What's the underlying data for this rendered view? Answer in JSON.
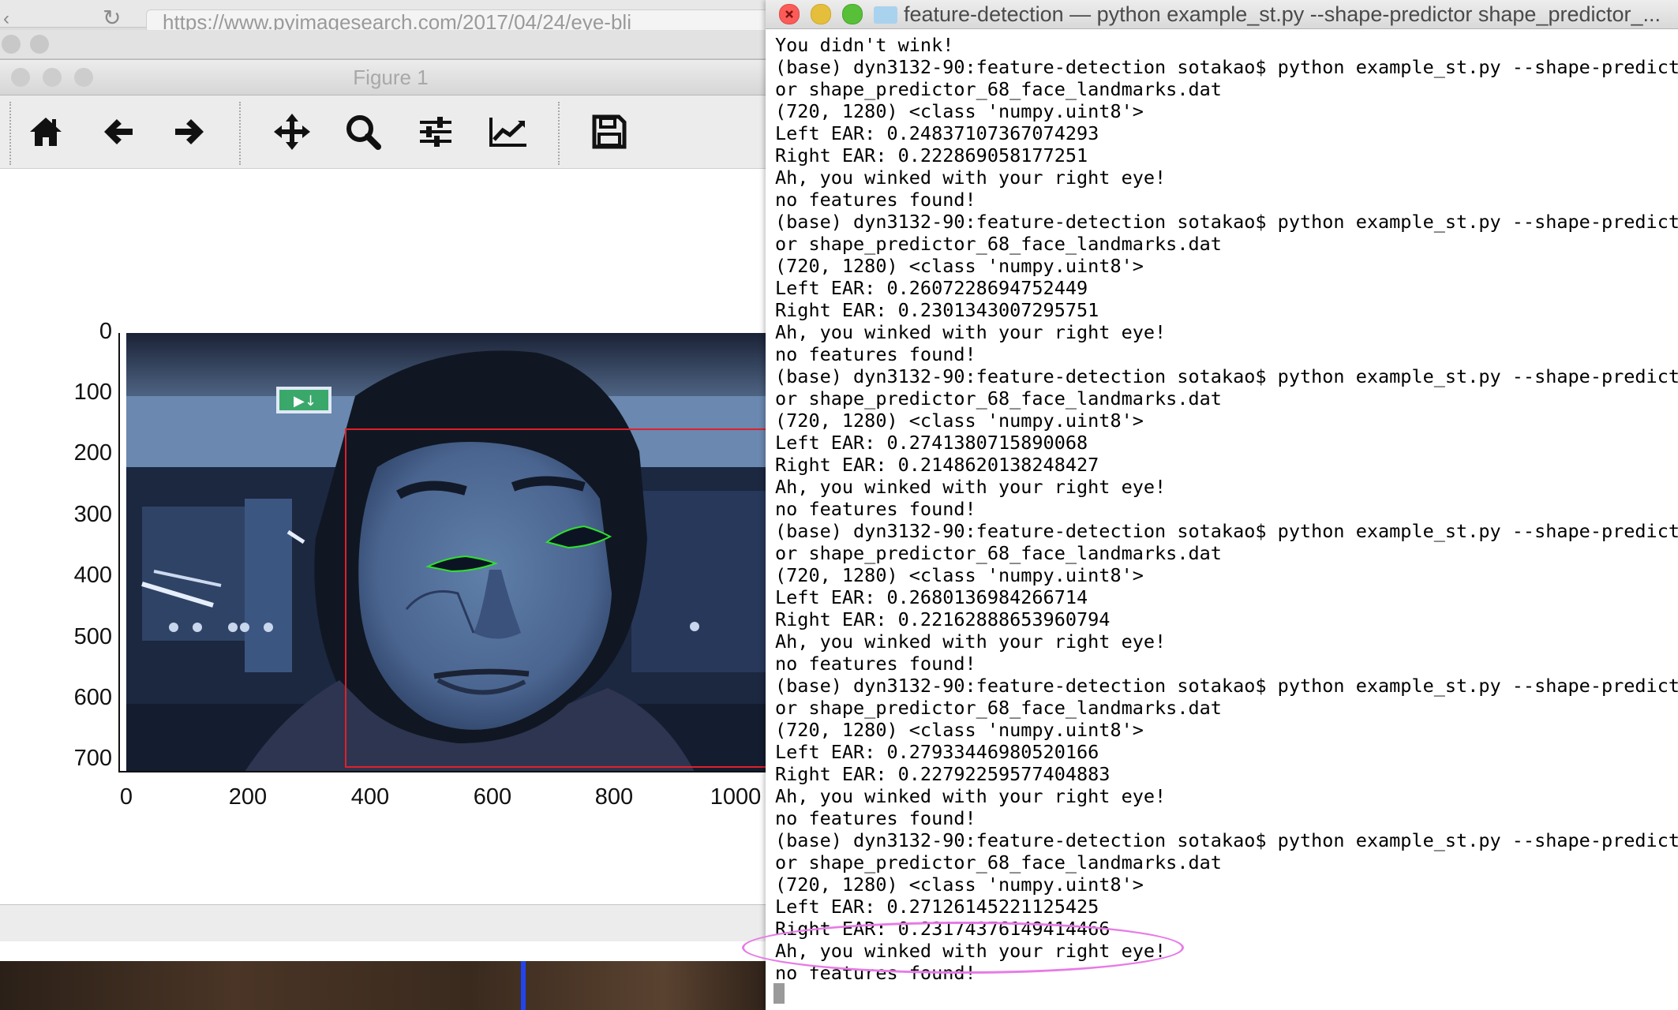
{
  "background_browser": {
    "address_text": "https://www.pyimagesearch.com/2017/04/24/eye-bli"
  },
  "figure_window": {
    "title": "Figure 1",
    "toolbar": {
      "home_icon": "home-icon",
      "back_icon": "arrow-left-icon",
      "forward_icon": "arrow-right-icon",
      "pan_icon": "move-icon",
      "zoom_icon": "magnifier-icon",
      "configure_icon": "sliders-icon",
      "edit_icon": "line-chart-icon",
      "save_icon": "floppy-disk-icon"
    },
    "plot": {
      "y_ticks": [
        "0",
        "100",
        "200",
        "300",
        "400",
        "500",
        "600",
        "700"
      ],
      "x_ticks": [
        "0",
        "200",
        "400",
        "600",
        "800",
        "1000"
      ],
      "exit_sign_text": "➔🏃"
    }
  },
  "terminal_window": {
    "title": "feature-detection — python example_st.py --shape-predictor shape_predictor_...",
    "lines": [
      "You didn't wink!",
      "(base) dyn3132-90:feature-detection sotakao$ python example_st.py --shape-predict",
      "or shape_predictor_68_face_landmarks.dat",
      "(720, 1280) <class 'numpy.uint8'>",
      "Left EAR: 0.24837107367074293",
      "Right EAR: 0.222869058177251",
      "Ah, you winked with your right eye!",
      "no features found!",
      "(base) dyn3132-90:feature-detection sotakao$ python example_st.py --shape-predict",
      "or shape_predictor_68_face_landmarks.dat",
      "(720, 1280) <class 'numpy.uint8'>",
      "Left EAR: 0.2607228694752449",
      "Right EAR: 0.2301343007295751",
      "Ah, you winked with your right eye!",
      "no features found!",
      "(base) dyn3132-90:feature-detection sotakao$ python example_st.py --shape-predict",
      "or shape_predictor_68_face_landmarks.dat",
      "(720, 1280) <class 'numpy.uint8'>",
      "Left EAR: 0.2741380715890068",
      "Right EAR: 0.2148620138248427",
      "Ah, you winked with your right eye!",
      "no features found!",
      "(base) dyn3132-90:feature-detection sotakao$ python example_st.py --shape-predict",
      "or shape_predictor_68_face_landmarks.dat",
      "(720, 1280) <class 'numpy.uint8'>",
      "Left EAR: 0.2680136984266714",
      "Right EAR: 0.22162888653960794",
      "Ah, you winked with your right eye!",
      "no features found!",
      "(base) dyn3132-90:feature-detection sotakao$ python example_st.py --shape-predict",
      "or shape_predictor_68_face_landmarks.dat",
      "(720, 1280) <class 'numpy.uint8'>",
      "Left EAR: 0.27933446980520166",
      "Right EAR: 0.22792259577404883",
      "Ah, you winked with your right eye!",
      "no features found!",
      "(base) dyn3132-90:feature-detection sotakao$ python example_st.py --shape-predict",
      "or shape_predictor_68_face_landmarks.dat",
      "(720, 1280) <class 'numpy.uint8'>",
      "Left EAR: 0.27126145221125425",
      "Right EAR: 0.23174376149414466",
      "Ah, you winked with your right eye!",
      "no features found!"
    ]
  },
  "colors": {
    "traffic_close": "#fc5b57",
    "traffic_minimize": "#e5bf3c",
    "traffic_zoom": "#57c038",
    "face_box": "#e0202a",
    "eye_contour": "#2fe02f",
    "annotation_ellipse": "#e77be6"
  }
}
